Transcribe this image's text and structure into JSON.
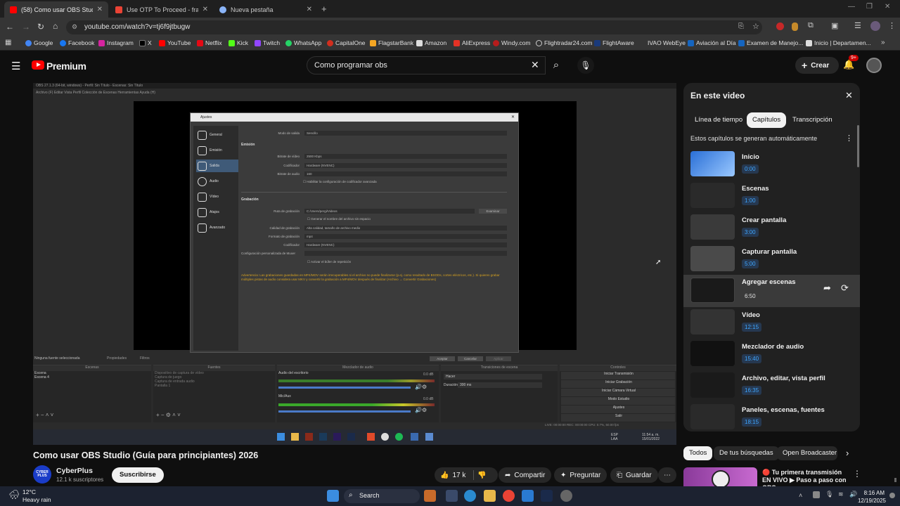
{
  "tabs": [
    {
      "title": "(58) Como usar OBS Studio (Gu",
      "icon": "youtube-icon",
      "active": true
    },
    {
      "title": "Use OTP To Proceed - franjaen",
      "icon": "gmail-icon",
      "active": false
    },
    {
      "title": "Nueva pestaña",
      "icon": "chrome-icon",
      "active": false
    }
  ],
  "url": "youtube.com/watch?v=tj6f9jtbugw",
  "bookmarks": [
    "Google",
    "Facebook",
    "Instagram",
    "X",
    "YouTube",
    "Netflix",
    "Kick",
    "Twitch",
    "WhatsApp",
    "CapitalOne",
    "FlagstarBank",
    "Amazon",
    "AliExpress",
    "Windy.com",
    "Flightradar24.com",
    "FlightAware",
    "IVAO WebEye",
    "Aviación al Día",
    "Examen de Manejo...",
    "Inicio | Departamen..."
  ],
  "yt": {
    "logo": "Premium",
    "search_value": "Como programar obs",
    "create_label": "Crear",
    "notif_count": "9+"
  },
  "obs": {
    "title_bar": "OBS 27.1.3 (64-bit, windows) - Perfil: Sin Título - Escenas: Sin Título",
    "menu": "Archivo (F)   Editar   Vista   Perfil   Colección de Escenas   Herramientas   Ayuda (H)",
    "dialog_title": "Ajustes",
    "side_items": [
      "General",
      "Emisión",
      "Salida",
      "Audio",
      "Vídeo",
      "Atajos",
      "Avanzado"
    ],
    "output_mode_label": "Modo de salida",
    "output_mode_value": "Sencillo",
    "section_emision": "Emisión",
    "bitrate_label": "Bitrate de vídeo",
    "bitrate_value": "2500 Kbps",
    "encoder_label": "Codificador",
    "encoder_value": "Hardware (NVENC)",
    "audio_bitrate_label": "Bitrate de audio",
    "audio_bitrate_value": "160",
    "adv_encoder_label": "Habilitar la configuración de codificador avanzada",
    "section_grabacion": "Grabación",
    "path_label": "Ruta de grabación",
    "path_value": "C:/Users/pergi/Videos",
    "browse_label": "Examinar",
    "nospace_label": "Generar el nombre del archivo sin espacio",
    "quality_label": "Calidad de grabación",
    "quality_value": "Alta calidad, tamaño de archivo medio",
    "format_label": "Formato de grabación",
    "format_value": "mp4",
    "rec_encoder_label": "Codificador",
    "rec_encoder_value": "Hardware (NVENC)",
    "muxer_label": "Configuración personalizada de Muxer",
    "replay_label": "Activar el búfer de repetición",
    "warning": "Advertencia: Las grabaciones guardadas en MP4/MOV serán irrecuperables si el archivo no puede finalizarse (p.ej. como resultado de BSODs, cortes eléctricos, etc.). Si quieres grabar múltiples pistas de audio considera usar MKV y convertir la grabación a MP4/MOV después de finalizar (Archivo → Convertir Grabaciones)",
    "accept": "Aceptar",
    "cancel": "Cancelar",
    "apply": "Aplicar",
    "no_source": "Ninguna fuente seleccionada",
    "props": "Propiedades",
    "filters": "Filtros",
    "docks": [
      "Escenas",
      "Fuentes",
      "Mezclador de audio",
      "Transiciones de escena",
      "Controles"
    ],
    "scenes": [
      "Escena",
      "Escena 4"
    ],
    "sources": [
      "Dispositivo de captura de vídeo",
      "Captura de juego",
      "Captura de entrada audio",
      "Pantalla 1"
    ],
    "mixer": [
      "Audio del escritorio",
      "Mic/Aux"
    ],
    "mixer_db": "0.0 dB",
    "transition": "Hacer",
    "duration_label": "Duración",
    "duration_value": "300 ms",
    "controls": [
      "Iniciar Transmisión",
      "Iniciar Grabación",
      "Iniciar Cámara Virtual",
      "Modo Estudio",
      "Ajustes",
      "Salir"
    ],
    "status": "LIVE: 00:00:00     REC: 00:00:00     CPU: 0.7%, 60.00 fps",
    "tray_lang": "ESP\nLAA",
    "tray_time": "11:54 a. m.\n15/01/2022"
  },
  "panel": {
    "title": "En este video",
    "chips": [
      "Línea de tiempo",
      "Capítulos",
      "Transcripción"
    ],
    "note": "Estos capítulos se generan automáticamente",
    "chapters": [
      {
        "title": "Inicio",
        "time": "0:00"
      },
      {
        "title": "Escenas",
        "time": "1:00"
      },
      {
        "title": "Crear pantalla",
        "time": "3:00"
      },
      {
        "title": "Capturar pantalla",
        "time": "5:00"
      },
      {
        "title": "Agregar escenas",
        "time": "6:50"
      },
      {
        "title": "Vídeo",
        "time": "12:15"
      },
      {
        "title": "Mezclador de audio",
        "time": "15:40"
      },
      {
        "title": "Archivo, editar, vista perfil",
        "time": "16:35"
      },
      {
        "title": "Paneles, escenas, fuentes",
        "time": "18:15"
      }
    ]
  },
  "video": {
    "title": "Como usar OBS Studio (Guía para principiantes) 2026",
    "channel": "CyberPlus",
    "avatar_text": "CYBER PLUS",
    "subs": "12.1 k suscriptores",
    "subscribe": "Suscribirse",
    "likes": "17 k",
    "share": "Compartir",
    "ask": "Preguntar",
    "save": "Guardar"
  },
  "filters": [
    "Todos",
    "De tus búsquedas",
    "Open Broadcaster"
  ],
  "rec": {
    "title": "🔴 Tu primera transmisión EN VIVO ▶ Paso a paso con OBS ..."
  },
  "taskbar": {
    "temp": "12°C",
    "weather": "Heavy rain",
    "search": "Search",
    "time": "8:16 AM",
    "date": "12/19/2025"
  }
}
